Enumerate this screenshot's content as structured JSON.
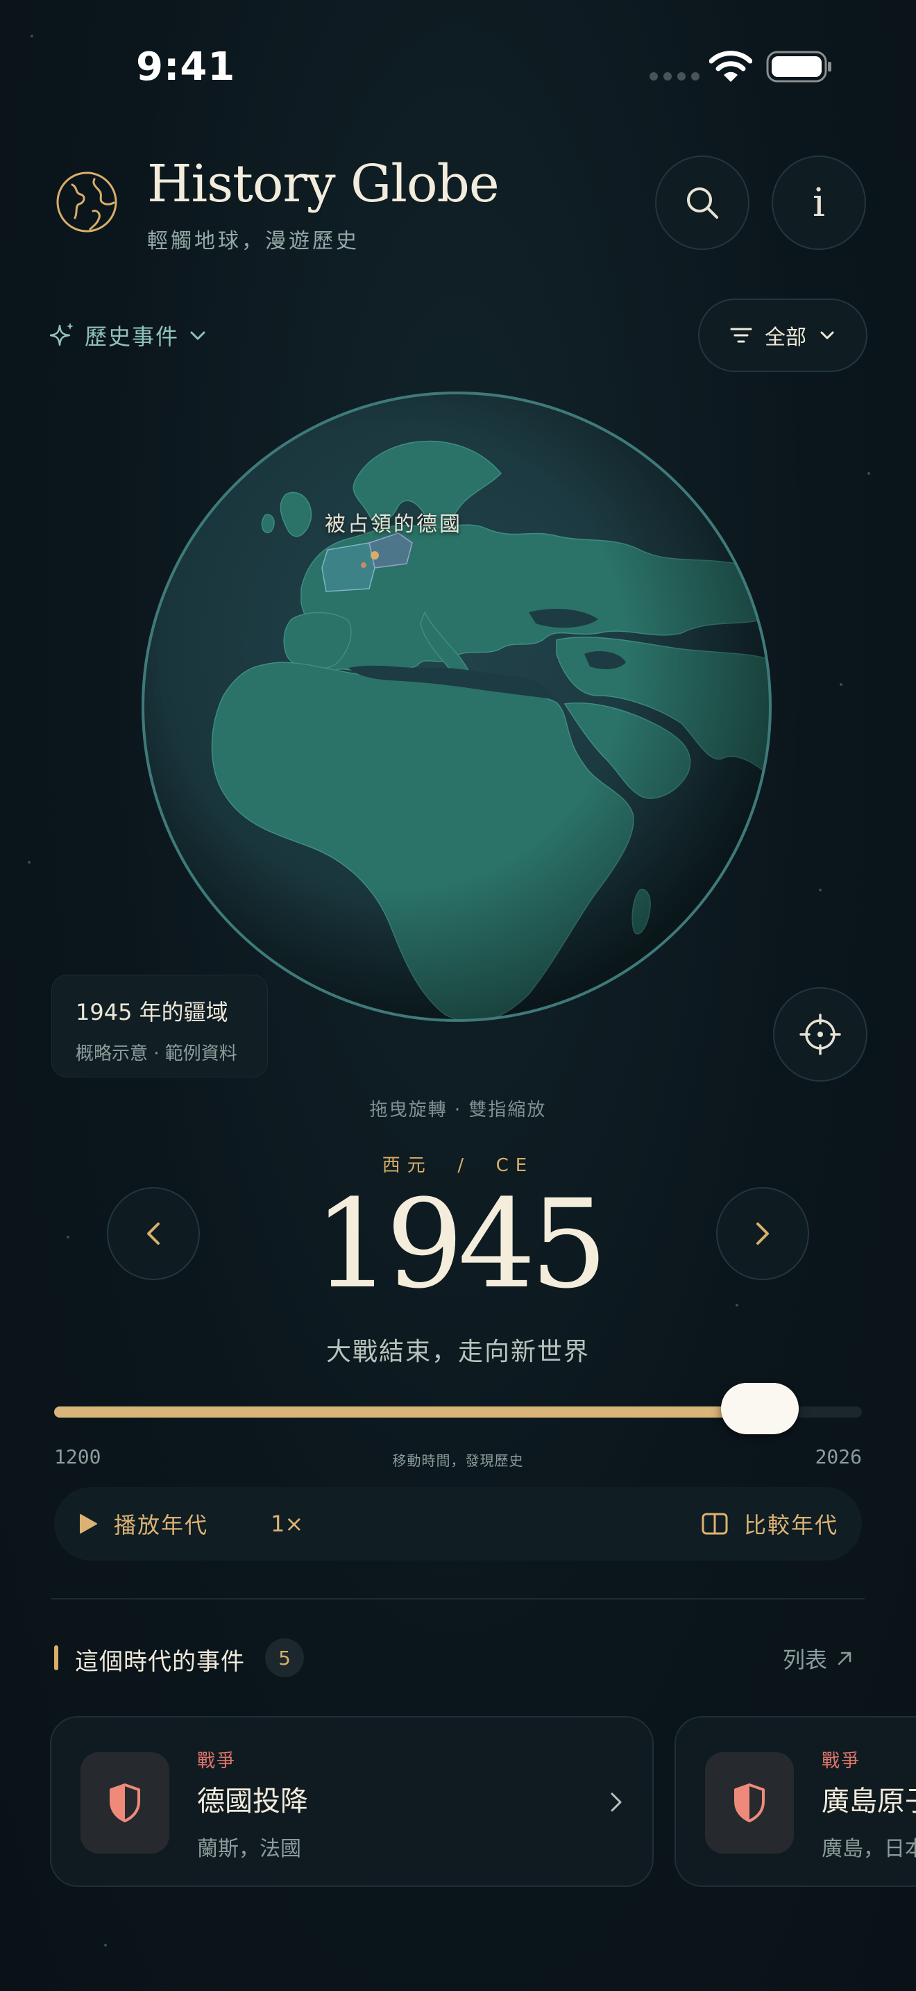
{
  "status_bar": {
    "time": "9:41"
  },
  "header": {
    "title": "History Globe",
    "subtitle": "輕觸地球，漫遊歷史",
    "search_icon": "search-icon",
    "info_icon": "info-icon",
    "info_glyph": "i"
  },
  "filters": {
    "category_label": "歷史事件",
    "filter_label": "全部"
  },
  "globe": {
    "region_label": "被占領的德國",
    "info_card": {
      "title": "1945 年的疆域",
      "subtitle": "概略示意 · 範例資料"
    },
    "gesture_hint": "拖曳旋轉 · 雙指縮放"
  },
  "timeline": {
    "era_label": "西元  /  CE",
    "year": "1945",
    "era_title": "大戰結束，走向新世界",
    "min": "1200",
    "max": "2026",
    "value_fraction": 0.874,
    "hint": "移動時間，發現歷史"
  },
  "playback": {
    "play_label": "播放年代",
    "speed": "1×",
    "compare_label": "比較年代"
  },
  "events": {
    "section_title": "這個時代的事件",
    "count": "5",
    "list_label": "列表",
    "items": [
      {
        "category": "戰爭",
        "title": "德國投降",
        "place": "蘭斯，法國"
      },
      {
        "category": "戰爭",
        "title": "廣島原子彈爆炸",
        "place": "廣島，日本"
      }
    ]
  },
  "colors": {
    "accent_gold": "#d8ae6a",
    "accent_teal": "#8fc3b8",
    "war_red": "#e0766a",
    "ocean": "#1d3f46",
    "land": "#2b7268"
  }
}
